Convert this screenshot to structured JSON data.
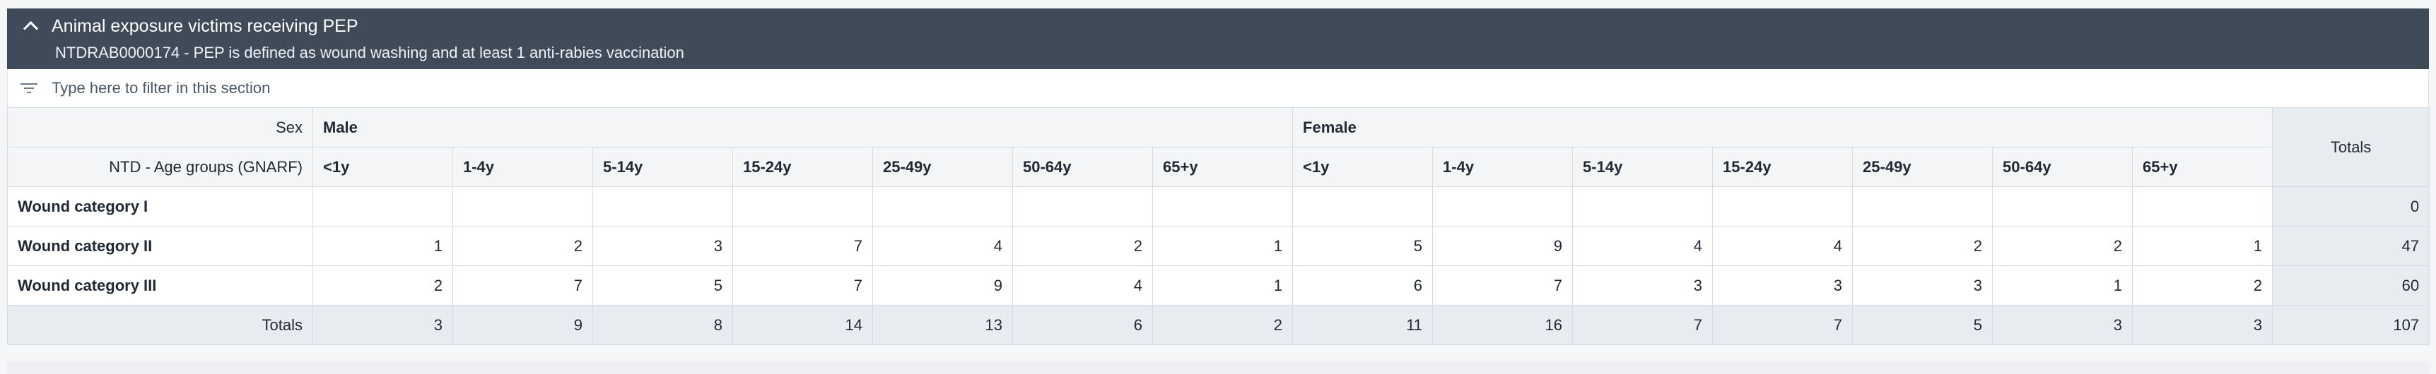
{
  "section": {
    "title": "Animal exposure victims receiving PEP",
    "description": "NTDRAB0000174 - PEP is defined as wound washing and at least 1 anti-rabies vaccination",
    "icon": "chevron-up-icon"
  },
  "filter": {
    "placeholder": "Type here to filter in this section",
    "icon": "filter-icon"
  },
  "table": {
    "sex_label": "Sex",
    "age_label": "NTD - Age groups (GNARF)",
    "totals_label": "Totals",
    "sexes": [
      "Male",
      "Female"
    ],
    "age_groups": [
      "<1y",
      "1-4y",
      "5-14y",
      "15-24y",
      "25-49y",
      "50-64y",
      "65+y"
    ],
    "rows": [
      {
        "label": "Wound category I",
        "values": [
          "",
          "",
          "",
          "",
          "",
          "",
          "",
          "",
          "",
          "",
          "",
          "",
          "",
          ""
        ],
        "total": "0"
      },
      {
        "label": "Wound category II",
        "values": [
          "1",
          "2",
          "3",
          "7",
          "4",
          "2",
          "1",
          "5",
          "9",
          "4",
          "4",
          "2",
          "2",
          "1"
        ],
        "total": "47"
      },
      {
        "label": "Wound category III",
        "values": [
          "2",
          "7",
          "5",
          "7",
          "9",
          "4",
          "1",
          "6",
          "7",
          "3",
          "3",
          "3",
          "1",
          "2"
        ],
        "total": "60"
      }
    ],
    "totals_row": {
      "label": "Totals",
      "values": [
        "3",
        "9",
        "8",
        "14",
        "13",
        "6",
        "2",
        "11",
        "16",
        "7",
        "7",
        "5",
        "3",
        "3"
      ],
      "total": "107"
    }
  }
}
